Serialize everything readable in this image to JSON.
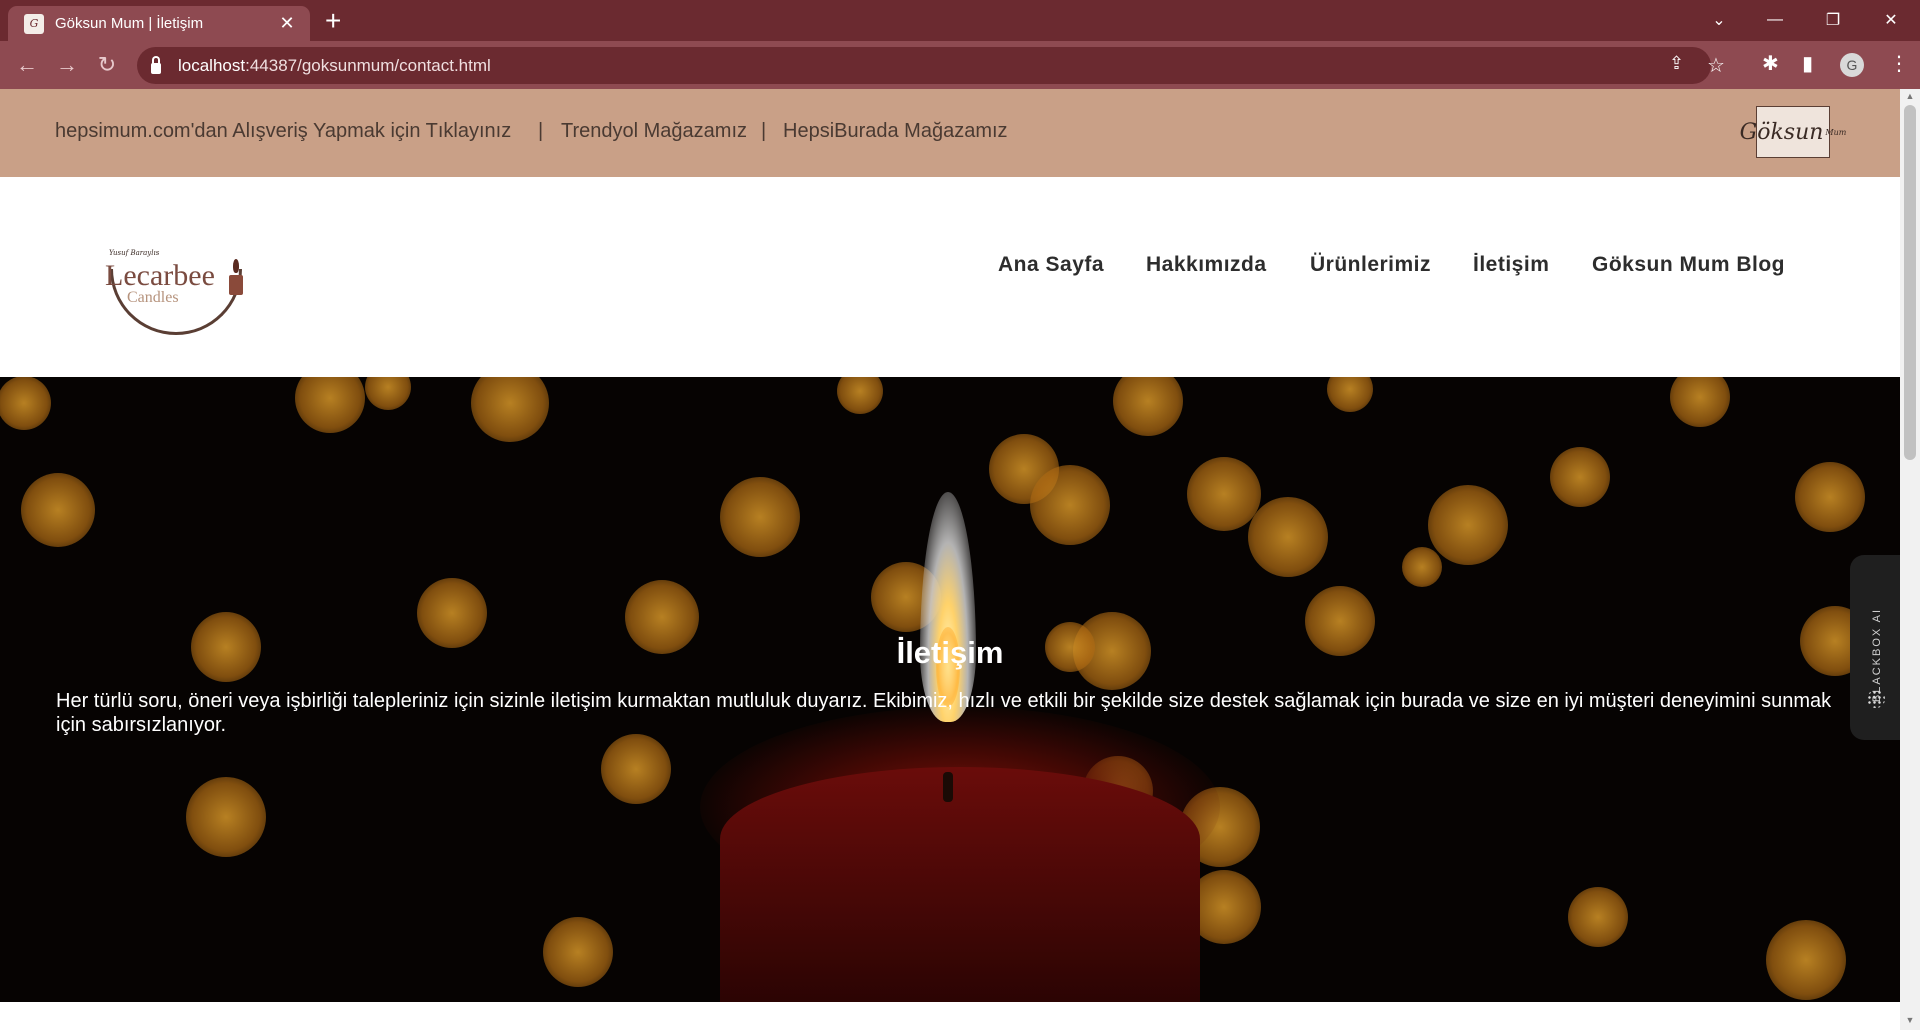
{
  "browser": {
    "tab_title": "Göksun Mum | İletişim",
    "tab_close": "✕",
    "new_tab": "+",
    "url_host": "localhost",
    "url_rest": ":44387/goksunmum/contact.html",
    "profile_initial": "G",
    "controls": {
      "tab_search": "⌄",
      "minimize": "—",
      "restore": "❐",
      "close": "✕"
    },
    "icons": {
      "back": "arrow-left-icon",
      "forward": "arrow-right-icon",
      "reload": "reload-icon",
      "lock": "lock-icon",
      "share": "share-icon",
      "bookmark": "star-icon",
      "extensions": "puzzle-icon",
      "side_panel": "side-panel-icon",
      "menu": "kebab-menu-icon"
    }
  },
  "topbar": {
    "link1": "hepsimum.com'dan Alışveriş Yapmak için Tıklayınız",
    "link2": "Trendyol Mağazamız",
    "link3": "HepsiBurada Mağazamız",
    "separator": "|",
    "logo_text": "Göksun",
    "logo_small": "Mum"
  },
  "brand": {
    "script": "Yusuf Baraylıs",
    "name": "Lecarbee",
    "sub": "Candles"
  },
  "nav": {
    "home": "Ana Sayfa",
    "about": "Hakkımızda",
    "products": "Ürünlerimiz",
    "contact": "İletişim",
    "blog": "Göksun Mum Blog"
  },
  "hero": {
    "title": "İletişim",
    "text": "Her türlü soru, öneri veya işbirliği talepleriniz için sizinle iletişim kurmaktan mutluluk duyarız. Ekibimiz, hızlı ve etkili bir şekilde size destek sağlamak için burada ve size en iyi müşteri deneyimini sunmak için sabırsızlanıyor."
  },
  "blackbox": {
    "label": "BLACKBOX AI"
  },
  "colors": {
    "chrome": "#6b2a30",
    "toolbar": "#8e4a51",
    "topbar": "#c9a087",
    "hero": "#060302",
    "bokeh": "#c8861a"
  }
}
